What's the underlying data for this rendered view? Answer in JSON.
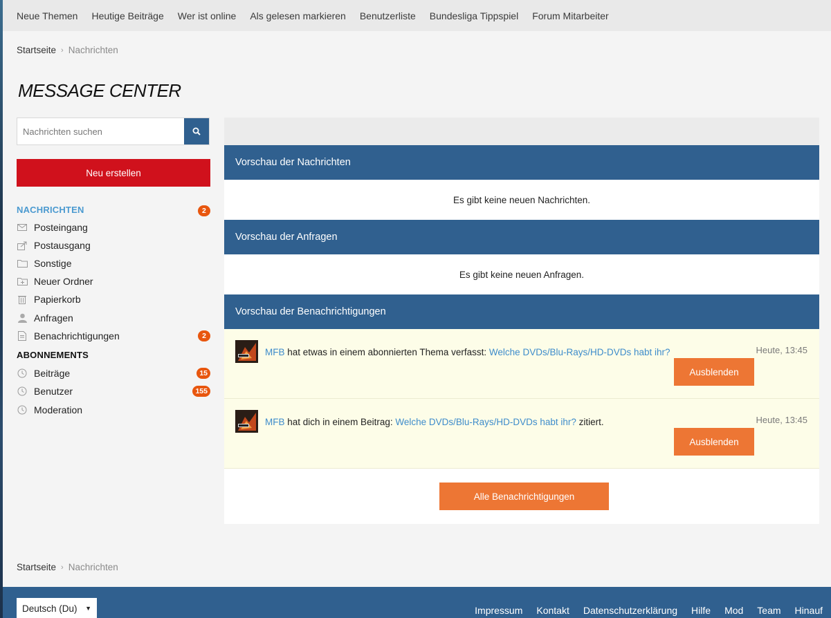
{
  "nav": {
    "items": [
      "Neue Themen",
      "Heutige Beiträge",
      "Wer ist online",
      "Als gelesen markieren",
      "Benutzerliste",
      "Bundesliga Tippspiel",
      "Forum Mitarbeiter"
    ]
  },
  "breadcrumb": {
    "home": "Startseite",
    "current": "Nachrichten"
  },
  "page_title": "MESSAGE CENTER",
  "search": {
    "placeholder": "Nachrichten suchen",
    "icon": "search-icon"
  },
  "sidebar": {
    "new_button": "Neu erstellen",
    "messages_heading": "NACHRICHTEN",
    "messages_badge": "2",
    "items": [
      {
        "label": "Posteingang",
        "icon": "inbox-icon"
      },
      {
        "label": "Postausgang",
        "icon": "outbox-icon"
      },
      {
        "label": "Sonstige",
        "icon": "folder-icon"
      },
      {
        "label": "Neuer Ordner",
        "icon": "new-folder-icon"
      },
      {
        "label": "Papierkorb",
        "icon": "trash-icon"
      },
      {
        "label": "Anfragen",
        "icon": "user-icon"
      },
      {
        "label": "Benachrichtigungen",
        "icon": "document-icon",
        "badge": "2"
      }
    ],
    "subscriptions_heading": "ABONNEMENTS",
    "subscriptions": [
      {
        "label": "Beiträge",
        "icon": "clock-icon",
        "badge": "15"
      },
      {
        "label": "Benutzer",
        "icon": "clock-icon",
        "badge": "155"
      },
      {
        "label": "Moderation",
        "icon": "clock-icon"
      }
    ]
  },
  "panels": {
    "messages": {
      "title": "Vorschau der Nachrichten",
      "empty": "Es gibt keine neuen Nachrichten."
    },
    "requests": {
      "title": "Vorschau der Anfragen",
      "empty": "Es gibt keine neuen Anfragen."
    },
    "notifications": {
      "title": "Vorschau der Benachrichtigungen",
      "items": [
        {
          "user": "MFB",
          "before": " hat etwas in einem abonnierten Thema verfasst: ",
          "thread": "Welche DVDs/Blu-Rays/HD-DVDs habt ihr?",
          "after": "",
          "time": "Heute, 13:45",
          "button": "Ausblenden"
        },
        {
          "user": "MFB",
          "before": " hat dich in einem Beitrag: ",
          "thread": "Welche DVDs/Blu-Rays/HD-DVDs habt ihr?",
          "after": " zitiert.",
          "time": "Heute, 13:45",
          "button": "Ausblenden"
        }
      ],
      "all_button": "Alle Benachrichtigungen"
    }
  },
  "footer": {
    "language": "Deutsch (Du)",
    "links": [
      "Impressum",
      "Kontakt",
      "Datenschutzerklärung",
      "Hilfe",
      "Mod",
      "Team",
      "Hinauf"
    ]
  },
  "colors": {
    "primary": "#30608f",
    "danger": "#d0111c",
    "accent": "#ed7634",
    "badge": "#e8560e",
    "link": "#3e8ccb"
  }
}
